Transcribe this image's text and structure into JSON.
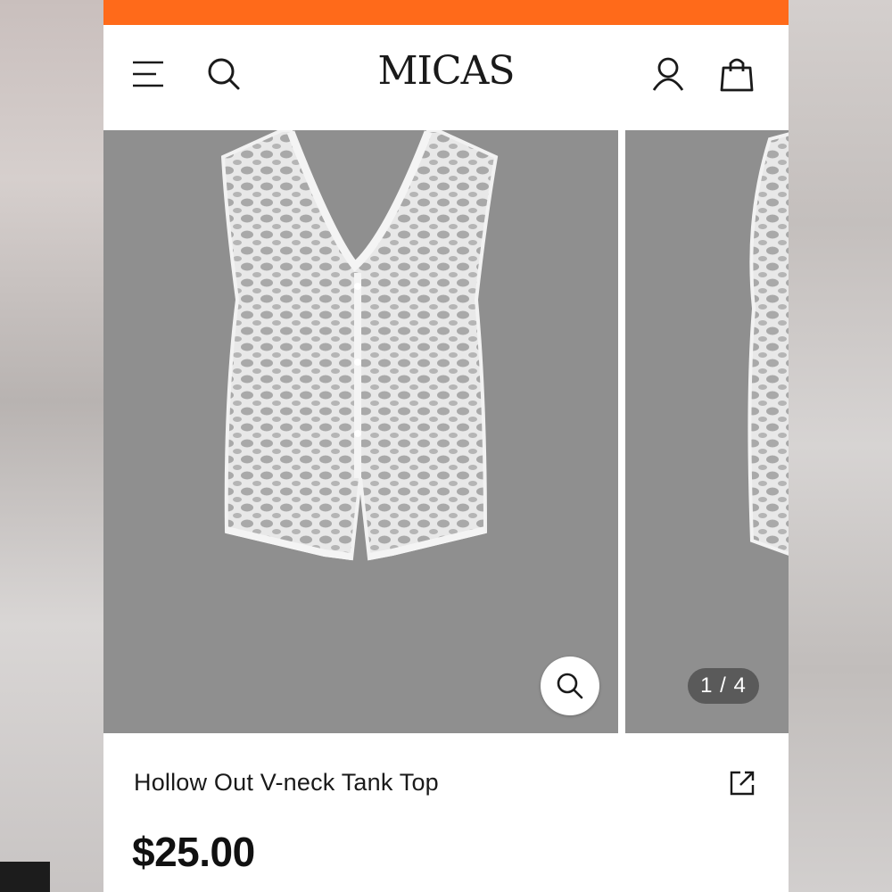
{
  "promo": {
    "text": ""
  },
  "header": {
    "logo": "MICAS",
    "icons": [
      "menu-icon",
      "search-icon",
      "account-icon",
      "shopping-bag-icon"
    ]
  },
  "gallery": {
    "counter": "1 / 4",
    "zoom_icon": "zoom-icon",
    "background_color": "#8f8f8f"
  },
  "product": {
    "title": "Hollow Out V-neck Tank Top",
    "price": "$25.00",
    "share_icon": "share-icon"
  },
  "colors": {
    "promo_bar": "#ff6a1a",
    "text": "#1a1a1a",
    "counter_bg": "#5a5a5a"
  }
}
